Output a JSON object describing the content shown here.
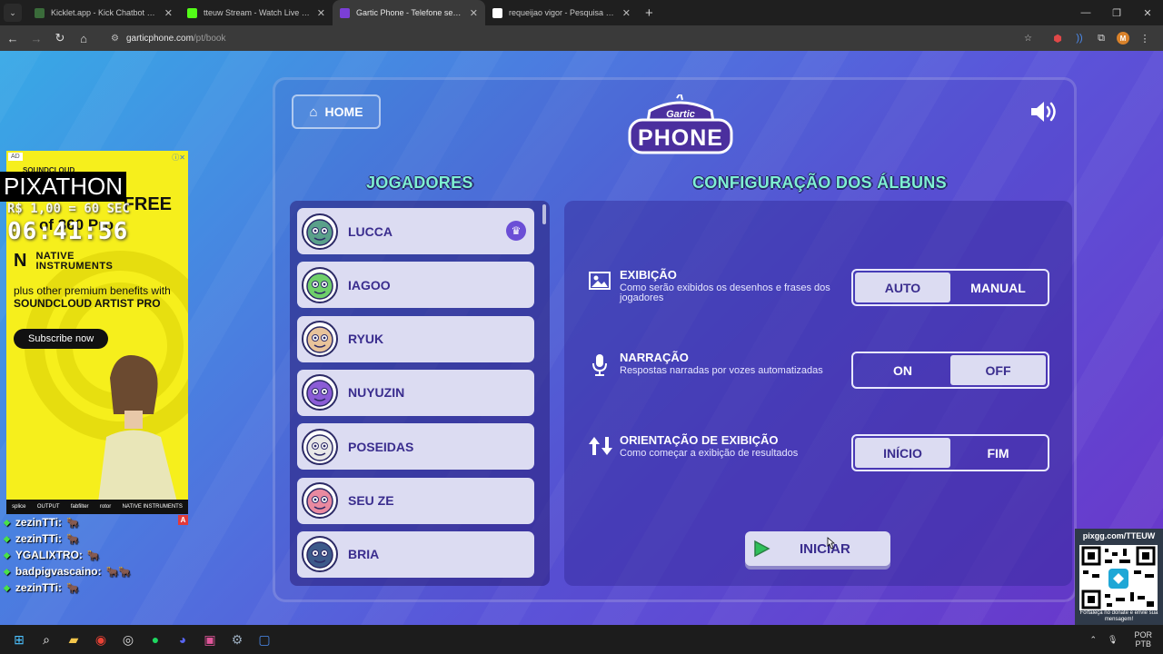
{
  "browser": {
    "tabs": [
      {
        "label": "Kicklet.app - Kick Chatbot and I",
        "color": "#3a6b3a",
        "active": false
      },
      {
        "label": "tteuw Stream - Watch Live on K",
        "color": "#53fc18",
        "active": false
      },
      {
        "label": "Gartic Phone - Telefone sem fio",
        "color": "#7b3fd6",
        "active": true
      },
      {
        "label": "requeijao vigor - Pesquisa Goo",
        "color": "#ffffff",
        "active": false
      }
    ],
    "url_host": "garticphone.com",
    "url_path": "/pt/book"
  },
  "game": {
    "home_label": "HOME",
    "logo_top": "Gartic",
    "logo_bottom": "PHONE",
    "players_title": "JOGADORES",
    "config_title": "CONFIGURAÇÃO DOS ÁLBUNS",
    "players": [
      {
        "name": "LUCCA",
        "icon": "player-avatar-icon",
        "color": "#5aa08a",
        "host": true
      },
      {
        "name": "IAGOO",
        "icon": "player-avatar-icon",
        "color": "#6fcf6a",
        "host": false
      },
      {
        "name": "RYUK",
        "icon": "player-avatar-icon",
        "color": "#e8c39a",
        "host": false
      },
      {
        "name": "NUYUZIN",
        "icon": "player-avatar-icon",
        "color": "#8b5cd6",
        "host": false
      },
      {
        "name": "POSEIDAS",
        "icon": "player-avatar-icon",
        "color": "#e8e8e8",
        "host": false
      },
      {
        "name": "SEU ZE",
        "icon": "player-avatar-icon",
        "color": "#e98aa0",
        "host": false
      },
      {
        "name": "BRIA",
        "icon": "player-avatar-icon",
        "color": "#3d5a8a",
        "host": false
      }
    ],
    "options": [
      {
        "title": "EXIBIÇÃO",
        "desc": "Como serão exibidos os desenhos e frases dos jogadores",
        "icon": "image-icon",
        "choices": [
          "AUTO",
          "MANUAL"
        ],
        "selected": 0
      },
      {
        "title": "NARRAÇÃO",
        "desc": "Respostas narradas por vozes automatizadas",
        "icon": "microphone-icon",
        "choices": [
          "ON",
          "OFF"
        ],
        "selected": 1
      },
      {
        "title": "ORIENTAÇÃO DE EXIBIÇÃO",
        "desc": "Como começar a exibição de resultados",
        "icon": "sort-arrows-icon",
        "choices": [
          "INÍCIO",
          "FIM"
        ],
        "selected": 0
      }
    ],
    "start_label": "INICIAR"
  },
  "overlay": {
    "ad": {
      "badge": "AD",
      "brand": "SOUNDCLOUD",
      "free_text": "FREE",
      "plugin_text": "of 360 Pro",
      "ni_line1": "NATIVE",
      "ni_line2": "INSTRUMENTS",
      "copy_line1": "plus other premium benefits with",
      "copy_line2": "SOUNDCLOUD ARTIST PRO",
      "cta": "Subscribe now",
      "footer": [
        "splice",
        "OUTPUT",
        "fabfilter",
        "rotor",
        "NATIVE INSTRUMENTS"
      ]
    },
    "pixathon": "PIXATHON",
    "timer_label": "R$ 1,00 = 60 SEC",
    "timer": "06:41:56",
    "chat": [
      {
        "user": "zezinTTi:",
        "emotes": "🐂"
      },
      {
        "user": "zezinTTi:",
        "emotes": "🐂"
      },
      {
        "user": "YGALIXTRO:",
        "emotes": "🐂"
      },
      {
        "user": "badpigvascaino:",
        "emotes": "🐂🐂"
      },
      {
        "user": "zezinTTi:",
        "emotes": "🐂"
      }
    ],
    "qr_title": "pixgg.com/TTEUW",
    "qr_note": "Fortaleça no donate e envie sua mensagem!"
  },
  "taskbar": {
    "lang_1": "POR",
    "lang_2": "PTB"
  }
}
